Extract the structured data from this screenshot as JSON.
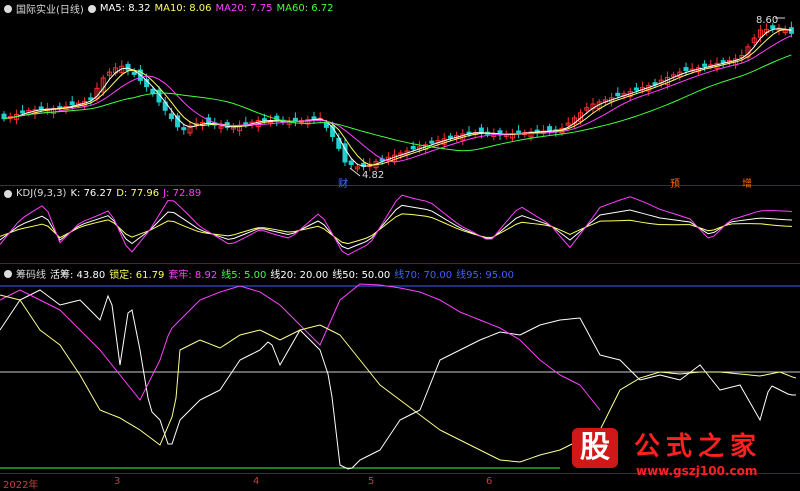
{
  "panels": {
    "main": {
      "title": "国际实业(日线)",
      "items": [
        {
          "label": "MA5: 8.32",
          "color": "#ffffff"
        },
        {
          "label": "MA10: 8.06",
          "color": "#ffff60"
        },
        {
          "label": "MA20: 7.75",
          "color": "#ff40ff"
        },
        {
          "label": "MA60: 6.72",
          "color": "#40ff40"
        }
      ],
      "high_label": "8.60",
      "low_label": "4.82",
      "markers": [
        {
          "text": "财",
          "color": "#4070ff"
        },
        {
          "text": "预",
          "color": "#ff6a00"
        },
        {
          "text": "增",
          "color": "#ff6a00"
        }
      ]
    },
    "kdj": {
      "title": "KDJ(9,3,3)",
      "items": [
        {
          "label": "K: 76.27",
          "color": "#ffffff"
        },
        {
          "label": "D: 77.96",
          "color": "#ffff60"
        },
        {
          "label": "J: 72.89",
          "color": "#ff40ff"
        }
      ]
    },
    "chip": {
      "title": "筹码线",
      "items": [
        {
          "label": "活筹: 43.80",
          "color": "#ffffff"
        },
        {
          "label": "锁定: 61.79",
          "color": "#ffff60"
        },
        {
          "label": "套牢: 8.92",
          "color": "#ff40ff"
        },
        {
          "label": "线5: 5.00",
          "color": "#40ff40"
        },
        {
          "label": "线20: 20.00",
          "color": "#ffffff"
        },
        {
          "label": "线50: 50.00",
          "color": "#ffffff"
        },
        {
          "label": "线70: 70.00",
          "color": "#4060ff"
        },
        {
          "label": "线95: 95.00",
          "color": "#4060ff"
        }
      ]
    }
  },
  "x_axis": [
    "2022年",
    "3",
    "4",
    "5",
    "6"
  ],
  "watermark": {
    "logo": "股",
    "text": "公式之家",
    "url": "www.gszj100.com"
  },
  "colors": {
    "up": "#ff3030",
    "down": "#20d0d0",
    "grid": "#8a1010"
  }
}
